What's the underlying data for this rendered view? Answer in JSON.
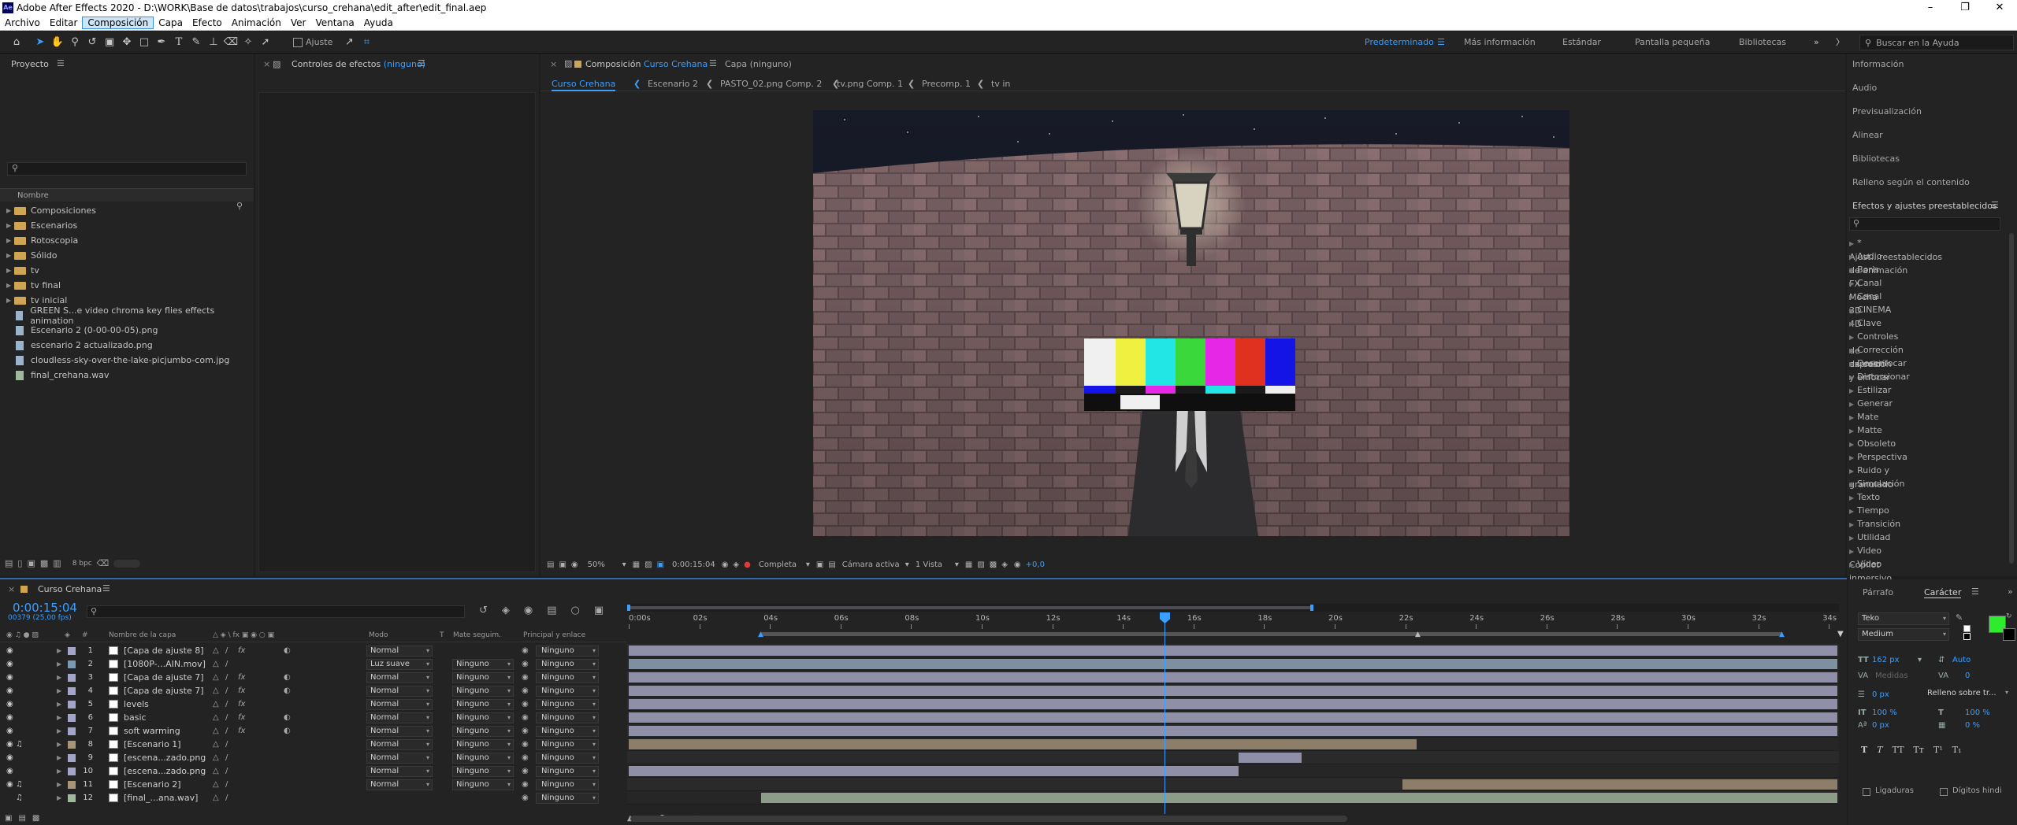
{
  "window": {
    "title": "Adobe After Effects 2020 - D:\\WORK\\Base de datos\\trabajos\\curso_crehana\\edit_after\\edit_final.aep",
    "app_icon": "Ae"
  },
  "menu": [
    "Archivo",
    "Editar",
    "Composición",
    "Capa",
    "Efecto",
    "Animación",
    "Ver",
    "Ventana",
    "Ayuda"
  ],
  "menu_selected": "Composición",
  "toolbar": {
    "snap_label": "Ajuste"
  },
  "workspaces": [
    "Predeterminado",
    "Más información",
    "Estándar",
    "Pantalla pequeña",
    "Bibliotecas"
  ],
  "search_help": {
    "placeholder": "Buscar en la Ayuda"
  },
  "project": {
    "title": "Proyecto",
    "name_header": "Nombre",
    "bpc": "8 bpc",
    "items": [
      {
        "label": "Composiciones",
        "type": "folder"
      },
      {
        "label": "Escenarios",
        "type": "folder"
      },
      {
        "label": "Rotoscopia",
        "type": "folder"
      },
      {
        "label": "Sólido",
        "type": "folder"
      },
      {
        "label": "tv",
        "type": "folder"
      },
      {
        "label": "tv final",
        "type": "folder"
      },
      {
        "label": "tv inicial",
        "type": "folder"
      },
      {
        "label": "GREEN S...e video  chroma key flies effects animation",
        "type": "file"
      },
      {
        "label": "Escenario 2 (0-00-00-05).png",
        "type": "file"
      },
      {
        "label": "escenario 2 actualizado.png",
        "type": "file"
      },
      {
        "label": "cloudless-sky-over-the-lake-picjumbo-com.jpg",
        "type": "file"
      },
      {
        "label": "final_crehana.wav",
        "type": "file"
      }
    ]
  },
  "effect_controls": {
    "title": "Controles de efectos",
    "target": "(ninguno)"
  },
  "composition": {
    "tab_prefix": "Composición",
    "tab_name": "Curso Crehana",
    "layer_tab": "Capa  (ninguno)",
    "breadcrumbs": [
      "Curso Crehana",
      "Escenario 2",
      "PASTO_02.png Comp. 2",
      "tv.png Comp. 1",
      "Precomp. 1",
      "tv in"
    ],
    "viewer_bar": {
      "zoom": "50%",
      "time": "0:00:15:04",
      "resolution": "Completa",
      "camera": "Cámara activa",
      "views": "1 Vista",
      "exposure": "+0,0"
    }
  },
  "right_panels": [
    "Información",
    "Audio",
    "Previsualización",
    "Alinear",
    "Bibliotecas",
    "Relleno según el contenido"
  ],
  "effects_presets": {
    "title": "Efectos y ajustes preestablecidos",
    "items": [
      "* Ajust...reestablecidos de animación",
      "Audio",
      "Boris FX Mocha",
      "Canal",
      "Canal 3D",
      "CINEMA 4D",
      "Clave",
      "Controles de expresión",
      "Corrección de color",
      "Desenfocar y enfocar",
      "Distorsionar",
      "Estilizar",
      "Generar",
      "Mate",
      "Matte",
      "Obsoleto",
      "Perspectiva",
      "Ruido y granulado",
      "Simulación",
      "Texto",
      "Tiempo",
      "Transición",
      "Utilidad",
      "Video Copilot",
      "Vídeo inmersivo"
    ]
  },
  "timeline": {
    "tab": "Curso Crehana",
    "current_time": "0:00:15:04",
    "frames": "00379 (25,00 fps)",
    "headers": {
      "name": "Nombre de la capa",
      "mode": "Modo",
      "t": "T",
      "mate": "Mate seguim.",
      "parent": "Principal y enlace"
    },
    "ruler": [
      "0:00s",
      "02s",
      "04s",
      "06s",
      "08s",
      "10s",
      "12s",
      "14s",
      "16s",
      "18s",
      "20s",
      "22s",
      "24s",
      "26s",
      "28s",
      "30s",
      "32s",
      "34s"
    ],
    "layers": [
      {
        "num": "1",
        "name": "[Capa de ajuste 8]",
        "mode": "Normal",
        "mate": "",
        "parent": "Ninguno",
        "color": "#a4a4c8"
      },
      {
        "num": "2",
        "name": "[1080P-...AIN.mov]",
        "mode": "Luz suave",
        "mate": "Ninguno",
        "parent": "Ninguno",
        "color": "#7a9ab4"
      },
      {
        "num": "3",
        "name": "[Capa de ajuste 7]",
        "mode": "Normal",
        "mate": "Ninguno",
        "parent": "Ninguno",
        "color": "#a4a4c8"
      },
      {
        "num": "4",
        "name": "[Capa de ajuste 7]",
        "mode": "Normal",
        "mate": "Ninguno",
        "parent": "Ninguno",
        "color": "#a4a4c8"
      },
      {
        "num": "5",
        "name": "levels",
        "mode": "Normal",
        "mate": "Ninguno",
        "parent": "Ninguno",
        "color": "#a4a4c8"
      },
      {
        "num": "6",
        "name": "basic",
        "mode": "Normal",
        "mate": "Ninguno",
        "parent": "Ninguno",
        "color": "#a4a4c8"
      },
      {
        "num": "7",
        "name": "soft warming",
        "mode": "Normal",
        "mate": "Ninguno",
        "parent": "Ninguno",
        "color": "#a4a4c8"
      },
      {
        "num": "8",
        "name": "[Escenario 1]",
        "mode": "Normal",
        "mate": "Ninguno",
        "parent": "Ninguno",
        "color": "#a89578"
      },
      {
        "num": "9",
        "name": "[escena...zado.png]",
        "mode": "Normal",
        "mate": "Ninguno",
        "parent": "Ninguno",
        "color": "#a4a4c8"
      },
      {
        "num": "10",
        "name": "[escena...zado.png]",
        "mode": "Normal",
        "mate": "Ninguno",
        "parent": "Ninguno",
        "color": "#a4a4c8"
      },
      {
        "num": "11",
        "name": "[Escenario 2]",
        "mode": "Normal",
        "mate": "Ninguno",
        "parent": "Ninguno",
        "color": "#a89578"
      },
      {
        "num": "12",
        "name": "[final_...ana.wav]",
        "mode": "",
        "mate": "",
        "parent": "Ninguno",
        "color": "#9fb79a"
      }
    ]
  },
  "paragraph_char": {
    "tabs": [
      "Párrafo",
      "Carácter"
    ],
    "font": "Teko",
    "style": "Medium",
    "size": "162 px",
    "leading": "Auto",
    "kerning": "Medidas",
    "tracking": "0",
    "stroke": "0 px",
    "stroke_mode": "Relleno sobre tr...",
    "vscale": "100 %",
    "hscale": "100 %",
    "baseline": "0 px",
    "tsume": "0 %",
    "ligatures": "Ligaduras",
    "hindi": "Dígitos hindi",
    "fill_color": "#2dec2d"
  }
}
